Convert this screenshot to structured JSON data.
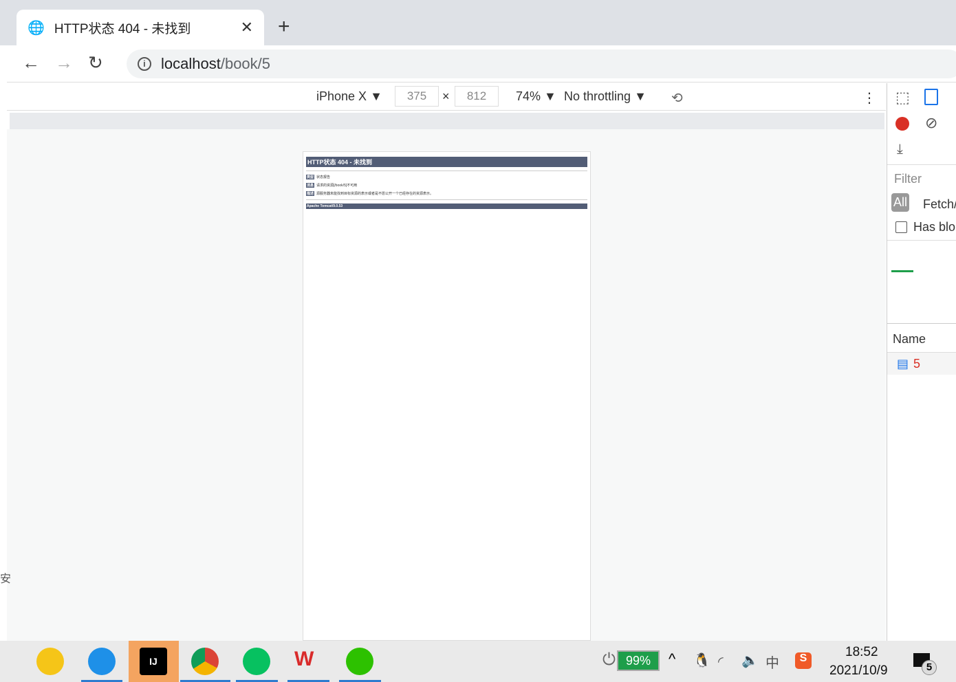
{
  "browser": {
    "tab_title": "HTTP状态 404 - 未找到",
    "url_host": "localhost",
    "url_path": "/book/5"
  },
  "device_toolbar": {
    "device": "iPhone X",
    "width": "375",
    "height": "812",
    "times": "×",
    "zoom": "74%",
    "throttling": "No throttling"
  },
  "page": {
    "title": "HTTP状态 404 - 未找到",
    "rows": [
      {
        "label": "类型",
        "text": "状态报告"
      },
      {
        "label": "消息",
        "text": "请求的资源[/book/5]不可用"
      },
      {
        "label": "描述",
        "text": "源服务器未能找到目标资源的表示或者是不愿公开一个已经存在的资源表示。"
      }
    ],
    "footer": "Apache Tomcat/9.0.53"
  },
  "devtools": {
    "filter_placeholder": "Filter",
    "chip_all": "All",
    "chip_fetch": "Fetch/",
    "has_blocked": "Has blo",
    "col_name": "Name",
    "request": "5",
    "record_color": "#d93025"
  },
  "taskbar": {
    "battery": "99%",
    "time": "18:52",
    "date": "2021/10/9",
    "notifications": "5",
    "left_char": "安"
  }
}
